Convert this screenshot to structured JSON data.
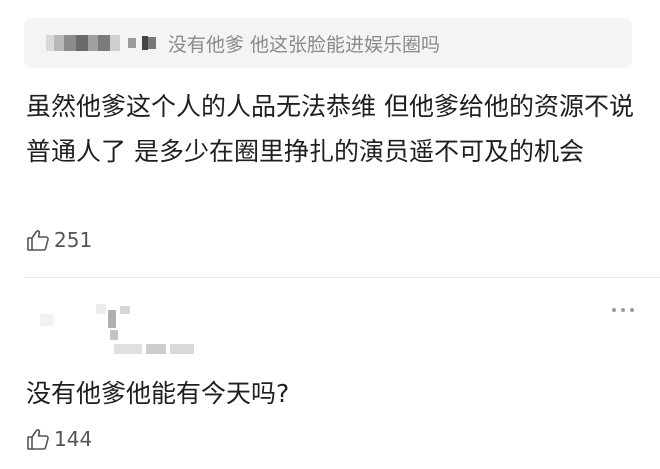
{
  "quoted_reply": {
    "text": "没有他爹 他这张脸能进娱乐圈吗"
  },
  "comments": [
    {
      "text": "虽然他爹这个人的人品无法恭维 但他爹给他的资源不说普通人了  是多少在圈里挣扎的演员遥不可及的机会",
      "likes": "251"
    },
    {
      "text": "没有他爹他能有今天吗?",
      "likes": "144"
    }
  ],
  "icons": {
    "like": "thumbs-up-icon",
    "more": "more-options-icon"
  }
}
